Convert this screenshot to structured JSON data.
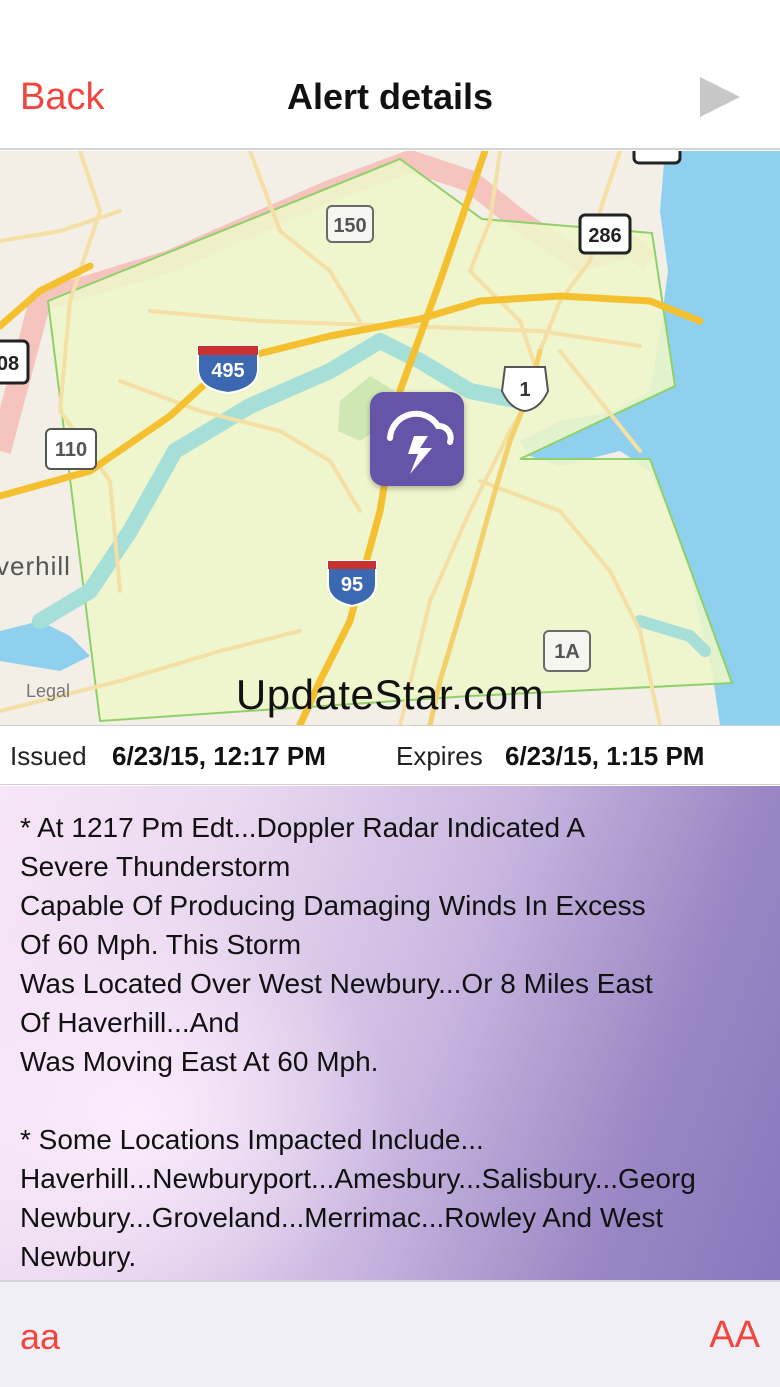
{
  "nav": {
    "back_label": "Back",
    "title": "Alert details",
    "next_icon": "play-triangle-icon"
  },
  "map": {
    "routes": [
      "150",
      "286",
      "08",
      "495",
      "1",
      "110",
      "95",
      "1A"
    ],
    "town": "verhill",
    "legal": "Legal",
    "watermark": "UpdateStar.com",
    "pin_icon": "thunderstorm-icon",
    "colors": {
      "land": "#f3efe6",
      "water": "#8fd0ee",
      "alert_area": "#eef6c8",
      "alert_border": "#8fd06a",
      "pin": "#6554a8"
    }
  },
  "times": {
    "issued_label": "Issued",
    "issued_value": "6/23/15, 12:17 PM",
    "expires_label": "Expires",
    "expires_value": "6/23/15, 1:15 PM"
  },
  "alert": {
    "text": "* At 1217 Pm Edt...Doppler Radar Indicated A\nSevere Thunderstorm\nCapable Of Producing Damaging Winds In Excess\nOf 60 Mph. This Storm\nWas Located Over West Newbury...Or 8 Miles East\nOf Haverhill...And\nWas Moving East At 60 Mph.\n\n* Some Locations Impacted Include...\nHaverhill...Newburyport...Amesbury...Salisbury...Georg\nNewbury...Groveland...Merrimac...Rowley And West\nNewbury."
  },
  "toolbar": {
    "smaller_label": "aa",
    "larger_label": "AA",
    "accent_color": "#f2453d"
  }
}
